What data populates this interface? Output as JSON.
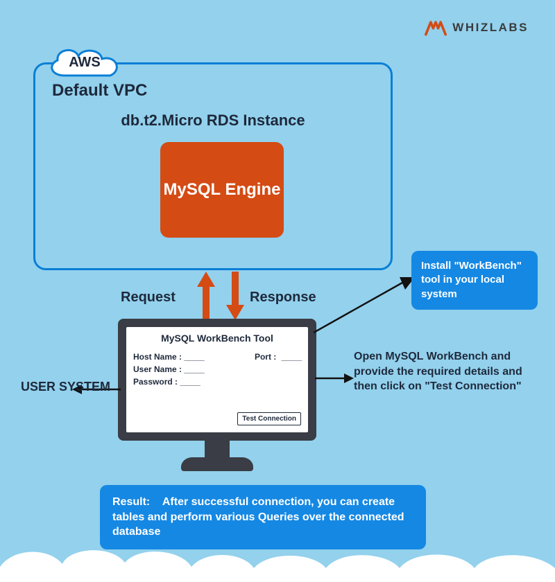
{
  "branding": {
    "name": "WHIZLABS"
  },
  "vpc": {
    "cloud_label": "AWS",
    "title": "Default VPC",
    "instance_label": "db.t2.Micro RDS Instance",
    "engine_label": "MySQL Engine"
  },
  "flow": {
    "request": "Request",
    "response": "Response"
  },
  "workbench": {
    "title": "MySQL WorkBench Tool",
    "fields": {
      "host": "Host Name :",
      "port": "Port :",
      "user": "User Name :",
      "password": "Password   :"
    },
    "blank": "_____",
    "test_button": "Test Connection"
  },
  "user_system_label": "USER SYSTEM",
  "callouts": {
    "install": "Install \"WorkBench\" tool in your local system",
    "open": "Open MySQL WorkBench and provide the required details and then click on \"Test Connection\""
  },
  "result": {
    "label": "Result:",
    "text": "After successful connection, you can create tables and perform various Queries over the connected database"
  }
}
